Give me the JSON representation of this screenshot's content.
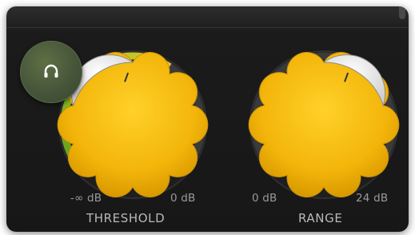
{
  "threshold": {
    "title": "THRESHOLD",
    "min_label": "-∞ dB",
    "max_label": "0 dB",
    "fill_level": 0.62
  },
  "range": {
    "title": "RANGE",
    "min_label": "0 dB",
    "max_label": "24 dB"
  },
  "headphone_button": {
    "icon": "headphones-icon"
  },
  "colors": {
    "knob_yellow": "#f2b705",
    "threshold_ring": "#b5cf2f",
    "panel_bg": "#1a1a1a"
  }
}
